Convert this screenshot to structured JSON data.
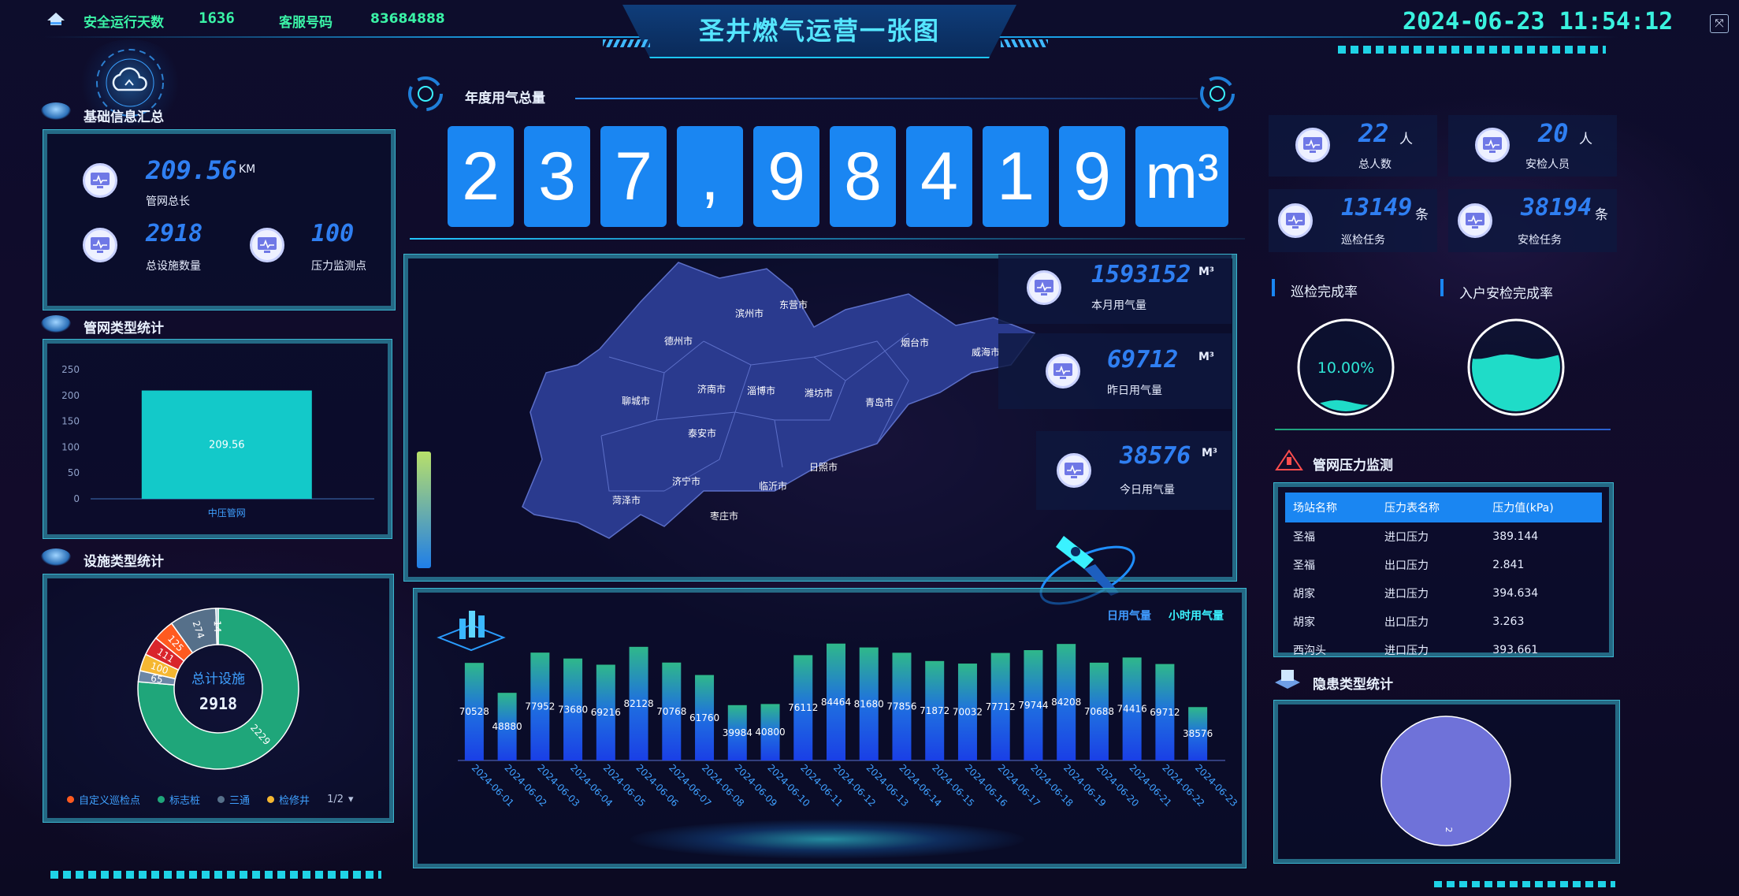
{
  "header": {
    "safe_days_label": "安全运行天数",
    "safe_days_value": "1636",
    "service_label": "客服号码",
    "service_number": "83684888",
    "title": "圣井燃气运营一张图",
    "datetime": "2024-06-23 11:54:12"
  },
  "basic_info": {
    "title": "基础信息汇总",
    "pipe_length_value": "209.56",
    "pipe_length_unit": "KM",
    "pipe_length_label": "管网总长",
    "facility_count_value": "2918",
    "facility_count_label": "总设施数量",
    "pressure_points_value": "100",
    "pressure_points_label": "压力监测点"
  },
  "pipe_type": {
    "title": "管网类型统计",
    "chart_data": {
      "type": "bar",
      "categories": [
        "中压管网"
      ],
      "values": [
        209.56
      ],
      "ylim": [
        0,
        250
      ],
      "yticks": [
        0,
        50,
        100,
        150,
        200,
        250
      ],
      "bar_color": "#13c9c9"
    }
  },
  "facility_type": {
    "title": "设施类型统计",
    "center_label": "总计设施",
    "center_value": "2918",
    "legend": [
      "自定义巡检点",
      "标志桩",
      "三通",
      "检修井"
    ],
    "legend_colors": [
      "#ff5a1f",
      "#1fa67a",
      "#56708a",
      "#f5b731"
    ],
    "pager": "1/2",
    "chart_data": {
      "type": "pie",
      "labels": [
        "标志桩",
        "检修井",
        "自定义巡检点",
        "",
        "",
        "",
        ""
      ],
      "values": [
        2229,
        65,
        100,
        111,
        125,
        274,
        14
      ],
      "slice_labels": [
        "2229",
        "65",
        "100",
        "111",
        "125",
        "274",
        "14"
      ],
      "colors": [
        "#1fa67a",
        "#6b86a6",
        "#f5b731",
        "#d9252b",
        "#ff5a1f",
        "#56708a",
        "#a8c8d8"
      ]
    }
  },
  "annual": {
    "title": "年度用气总量",
    "digits": [
      "2",
      "3",
      "7",
      ",",
      "9",
      "8",
      "4",
      "1",
      "9"
    ],
    "unit": "m³"
  },
  "map_stats": [
    {
      "value": "1593152",
      "unit": "M³",
      "label": "本月用气量"
    },
    {
      "value": "69712",
      "unit": "M³",
      "label": "昨日用气量"
    },
    {
      "value": "38576",
      "unit": "M³",
      "label": "今日用气量"
    }
  ],
  "cities": [
    "滨州市",
    "东营市",
    "德州市",
    "烟台市",
    "威海市",
    "济南市",
    "淄博市",
    "潍坊市",
    "青岛市",
    "聊城市",
    "泰安市",
    "日照市",
    "济宁市",
    "临沂市",
    "菏泽市",
    "枣庄市"
  ],
  "daily": {
    "tab_day": "日用气量",
    "tab_hour": "小时用气量",
    "chart_data": {
      "type": "bar",
      "categories": [
        "2024-06-01",
        "2024-06-02",
        "2024-06-03",
        "2024-06-04",
        "2024-06-05",
        "2024-06-06",
        "2024-06-07",
        "2024-06-08",
        "2024-06-09",
        "2024-06-10",
        "2024-06-11",
        "2024-06-12",
        "2024-06-13",
        "2024-06-14",
        "2024-06-15",
        "2024-06-16",
        "2024-06-17",
        "2024-06-18",
        "2024-06-19",
        "2024-06-20",
        "2024-06-21",
        "2024-06-22",
        "2024-06-23"
      ],
      "values": [
        70528,
        48880,
        77952,
        73680,
        69216,
        82128,
        70768,
        61760,
        39984,
        40800,
        76112,
        84464,
        81680,
        77856,
        71872,
        70032,
        77712,
        79744,
        84208,
        70688,
        74416,
        69712,
        38576
      ],
      "ylim": [
        0,
        90000
      ]
    }
  },
  "personnel": [
    {
      "value": "22",
      "unit": "人",
      "label": "总人数"
    },
    {
      "value": "20",
      "unit": "人",
      "label": "安检人员"
    },
    {
      "value": "13149",
      "unit": "条",
      "label": "巡检任务"
    },
    {
      "value": "38194",
      "unit": "条",
      "label": "安检任务"
    }
  ],
  "rates": {
    "patrol_title": "巡检完成率",
    "patrol_value": "10.00%",
    "patrol_level": 0.1,
    "home_title": "入户安检完成率",
    "home_level": 0.62
  },
  "pressure": {
    "title": "管网压力监测",
    "headers": [
      "场站名称",
      "压力表名称",
      "压力值(kPa)"
    ],
    "rows": [
      [
        "圣福",
        "进口压力",
        "389.144"
      ],
      [
        "圣福",
        "出口压力",
        "2.841"
      ],
      [
        "胡家",
        "进口压力",
        "394.634"
      ],
      [
        "胡家",
        "出口压力",
        "3.263"
      ],
      [
        "西沟头",
        "进口压力",
        "393.661"
      ]
    ]
  },
  "hazard": {
    "title": "隐患类型统计",
    "chart_data": {
      "type": "pie",
      "values": [
        2
      ],
      "slice_labels": [
        "2"
      ],
      "colors": [
        "#6f72d9"
      ]
    }
  }
}
